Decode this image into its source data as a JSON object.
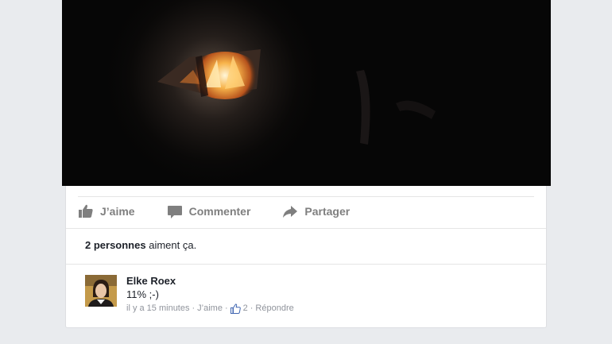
{
  "post": {
    "actions": {
      "like": "J’aime",
      "comment": "Commenter",
      "share": "Partager"
    },
    "likes_summary": {
      "count_text": "2 personnes",
      "suffix": "aiment ça."
    },
    "comment": {
      "author": "Elke Roex",
      "text": "11% ;-)",
      "time": "il y a 15 minutes",
      "like_link": "J’aime",
      "like_count": "2",
      "reply_link": "Répondre",
      "separator": "·"
    }
  },
  "colors": {
    "action_gray": "#7f7f7f",
    "meta_gray": "#90949c",
    "like_blue": "#4267b2"
  },
  "icons": {
    "like": "thumbs-up-icon",
    "comment": "speech-bubble-icon",
    "share": "share-arrow-icon",
    "comment_like": "thumbs-up-outline-icon"
  }
}
